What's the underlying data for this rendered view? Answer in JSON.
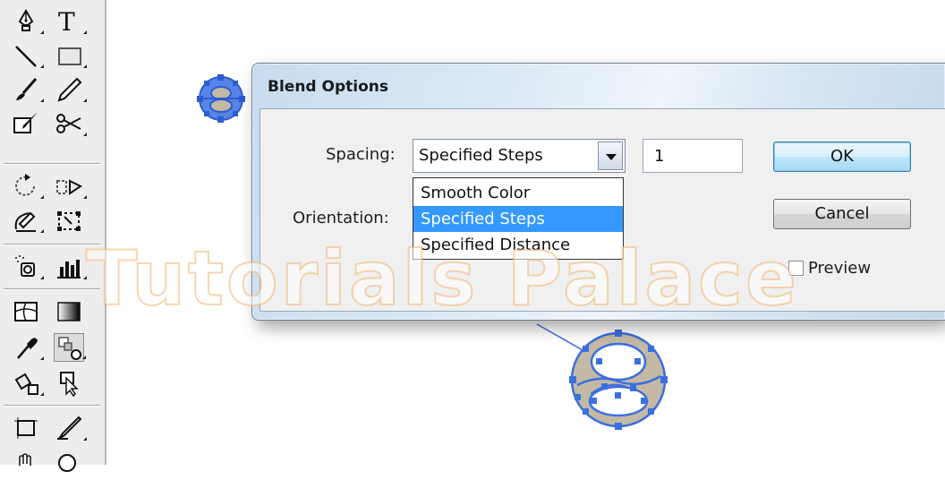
{
  "toolbar": {
    "tools": [
      [
        "pen-tool",
        "type-tool"
      ],
      [
        "line-segment-tool",
        "rectangle-tool"
      ],
      [
        "paintbrush-tool",
        "pencil-tool"
      ],
      [
        "blob-brush-tool",
        "scissors-tool"
      ],
      [
        "rotate-tool",
        "reflect-tool"
      ],
      [
        "warp-tool",
        "free-transform-tool"
      ],
      [
        "symbol-sprayer-tool",
        "column-graph-tool"
      ],
      [
        "mesh-tool",
        "gradient-tool"
      ],
      [
        "eyedropper-tool",
        "blend-tool"
      ],
      [
        "live-paint-bucket-tool",
        "live-paint-selection-tool"
      ],
      [
        "artboard-tool",
        "slice-tool"
      ],
      [
        "hand-tool",
        "zoom-tool"
      ]
    ],
    "type_tool_glyph": "T"
  },
  "dialog": {
    "title": "Blend Options",
    "spacing_label": "Spacing:",
    "spacing_value": "Specified Steps",
    "spacing_options": [
      "Smooth Color",
      "Specified Steps",
      "Specified Distance"
    ],
    "selected_option": "Specified Steps",
    "orientation_label": "Orientation:",
    "steps_value": "1",
    "ok_label": "OK",
    "cancel_label": "Cancel",
    "preview_label": "Preview",
    "preview_checked": false
  },
  "watermark": "Tutorials Palace",
  "colors": {
    "selection_blue": "#3a6fe0",
    "highlight": "#3399ff",
    "shape_fill": "#c3b9a4"
  }
}
